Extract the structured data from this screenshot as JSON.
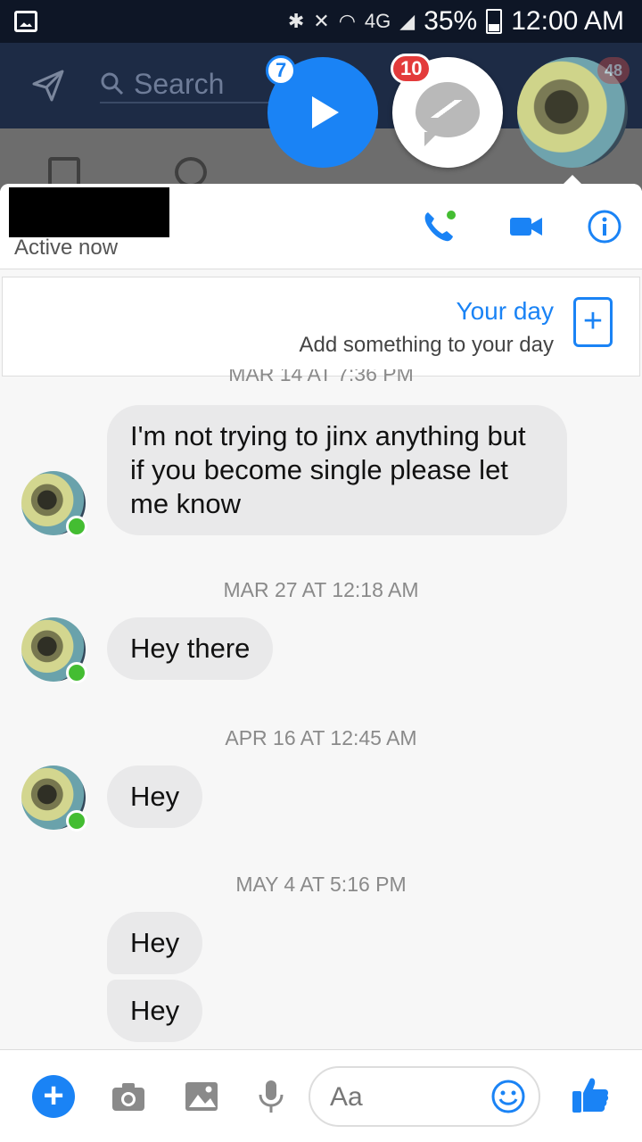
{
  "status_bar": {
    "battery": "35%",
    "time": "12:00 AM",
    "network": "4G"
  },
  "app_bar": {
    "search_placeholder": "Search"
  },
  "chat_heads": {
    "video_badge": "7",
    "messenger_badge": "10",
    "photo_badge": "48"
  },
  "chat_header": {
    "status": "Active now"
  },
  "your_day": {
    "title": "Your day",
    "subtitle": "Add something to your day"
  },
  "conversation": {
    "partial_timestamp": "MAR 14 AT 7:36 PM",
    "groups": [
      {
        "timestamp": null,
        "messages": [
          "I'm not trying to jinx anything but if you become single please let me know"
        ]
      },
      {
        "timestamp": "MAR 27 AT 12:18 AM",
        "messages": [
          "Hey there"
        ]
      },
      {
        "timestamp": "APR 16 AT 12:45 AM",
        "messages": [
          "Hey"
        ]
      },
      {
        "timestamp": "MAY 4 AT 5:16 PM",
        "messages": [
          "Hey",
          "Hey"
        ]
      }
    ]
  },
  "composer": {
    "placeholder": "Aa"
  },
  "colors": {
    "accent": "#1a83f5",
    "online": "#44bd32",
    "bubble": "#e9e9ea",
    "badge_red": "#e33b3b"
  }
}
